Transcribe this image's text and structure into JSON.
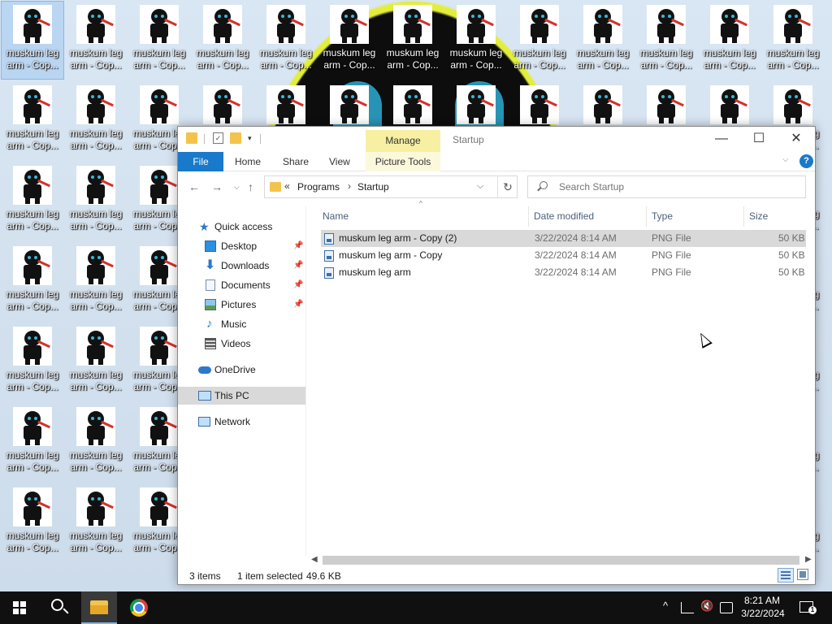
{
  "desktop": {
    "icon_label": "muskum leg arm - Cop...",
    "rows_full": 2,
    "rows_partial": 5
  },
  "explorer": {
    "title": "Startup",
    "quick_access_toolbar_dropdown": "▾",
    "contextual_tab_group": "Manage",
    "ribbon_tabs": {
      "file": "File",
      "home": "Home",
      "share": "Share",
      "view": "View",
      "picture_tools": "Picture Tools"
    },
    "window_controls": {
      "minimize": "—",
      "maximize": "☐",
      "close": "✕"
    },
    "address": {
      "chevron": "«",
      "crumbs": [
        "Programs",
        "Startup"
      ],
      "separator": "›",
      "dropdown": "⌵",
      "refresh": "↻"
    },
    "search": {
      "placeholder": "Search Startup"
    },
    "nav": {
      "quick_access": "Quick access",
      "items": [
        {
          "label": "Desktop",
          "pinned": true
        },
        {
          "label": "Downloads",
          "pinned": true
        },
        {
          "label": "Documents",
          "pinned": true
        },
        {
          "label": "Pictures",
          "pinned": true
        },
        {
          "label": "Music",
          "pinned": false
        },
        {
          "label": "Videos",
          "pinned": false
        }
      ],
      "onedrive": "OneDrive",
      "this_pc": "This PC",
      "network": "Network"
    },
    "columns": {
      "name": "Name",
      "date_modified": "Date modified",
      "type": "Type",
      "size": "Size"
    },
    "files": [
      {
        "name": "muskum leg arm - Copy (2)",
        "date": "3/22/2024 8:14 AM",
        "type": "PNG File",
        "size": "50 KB",
        "selected": true
      },
      {
        "name": "muskum leg arm - Copy",
        "date": "3/22/2024 8:14 AM",
        "type": "PNG File",
        "size": "50 KB",
        "selected": false
      },
      {
        "name": "muskum leg arm",
        "date": "3/22/2024 8:14 AM",
        "type": "PNG File",
        "size": "50 KB",
        "selected": false
      }
    ],
    "status": {
      "item_count": "3 items",
      "selection": "1 item selected",
      "selection_size": "49.6 KB"
    }
  },
  "taskbar": {
    "clock_time": "8:21 AM",
    "clock_date": "3/22/2024",
    "notifications_count": "1"
  }
}
